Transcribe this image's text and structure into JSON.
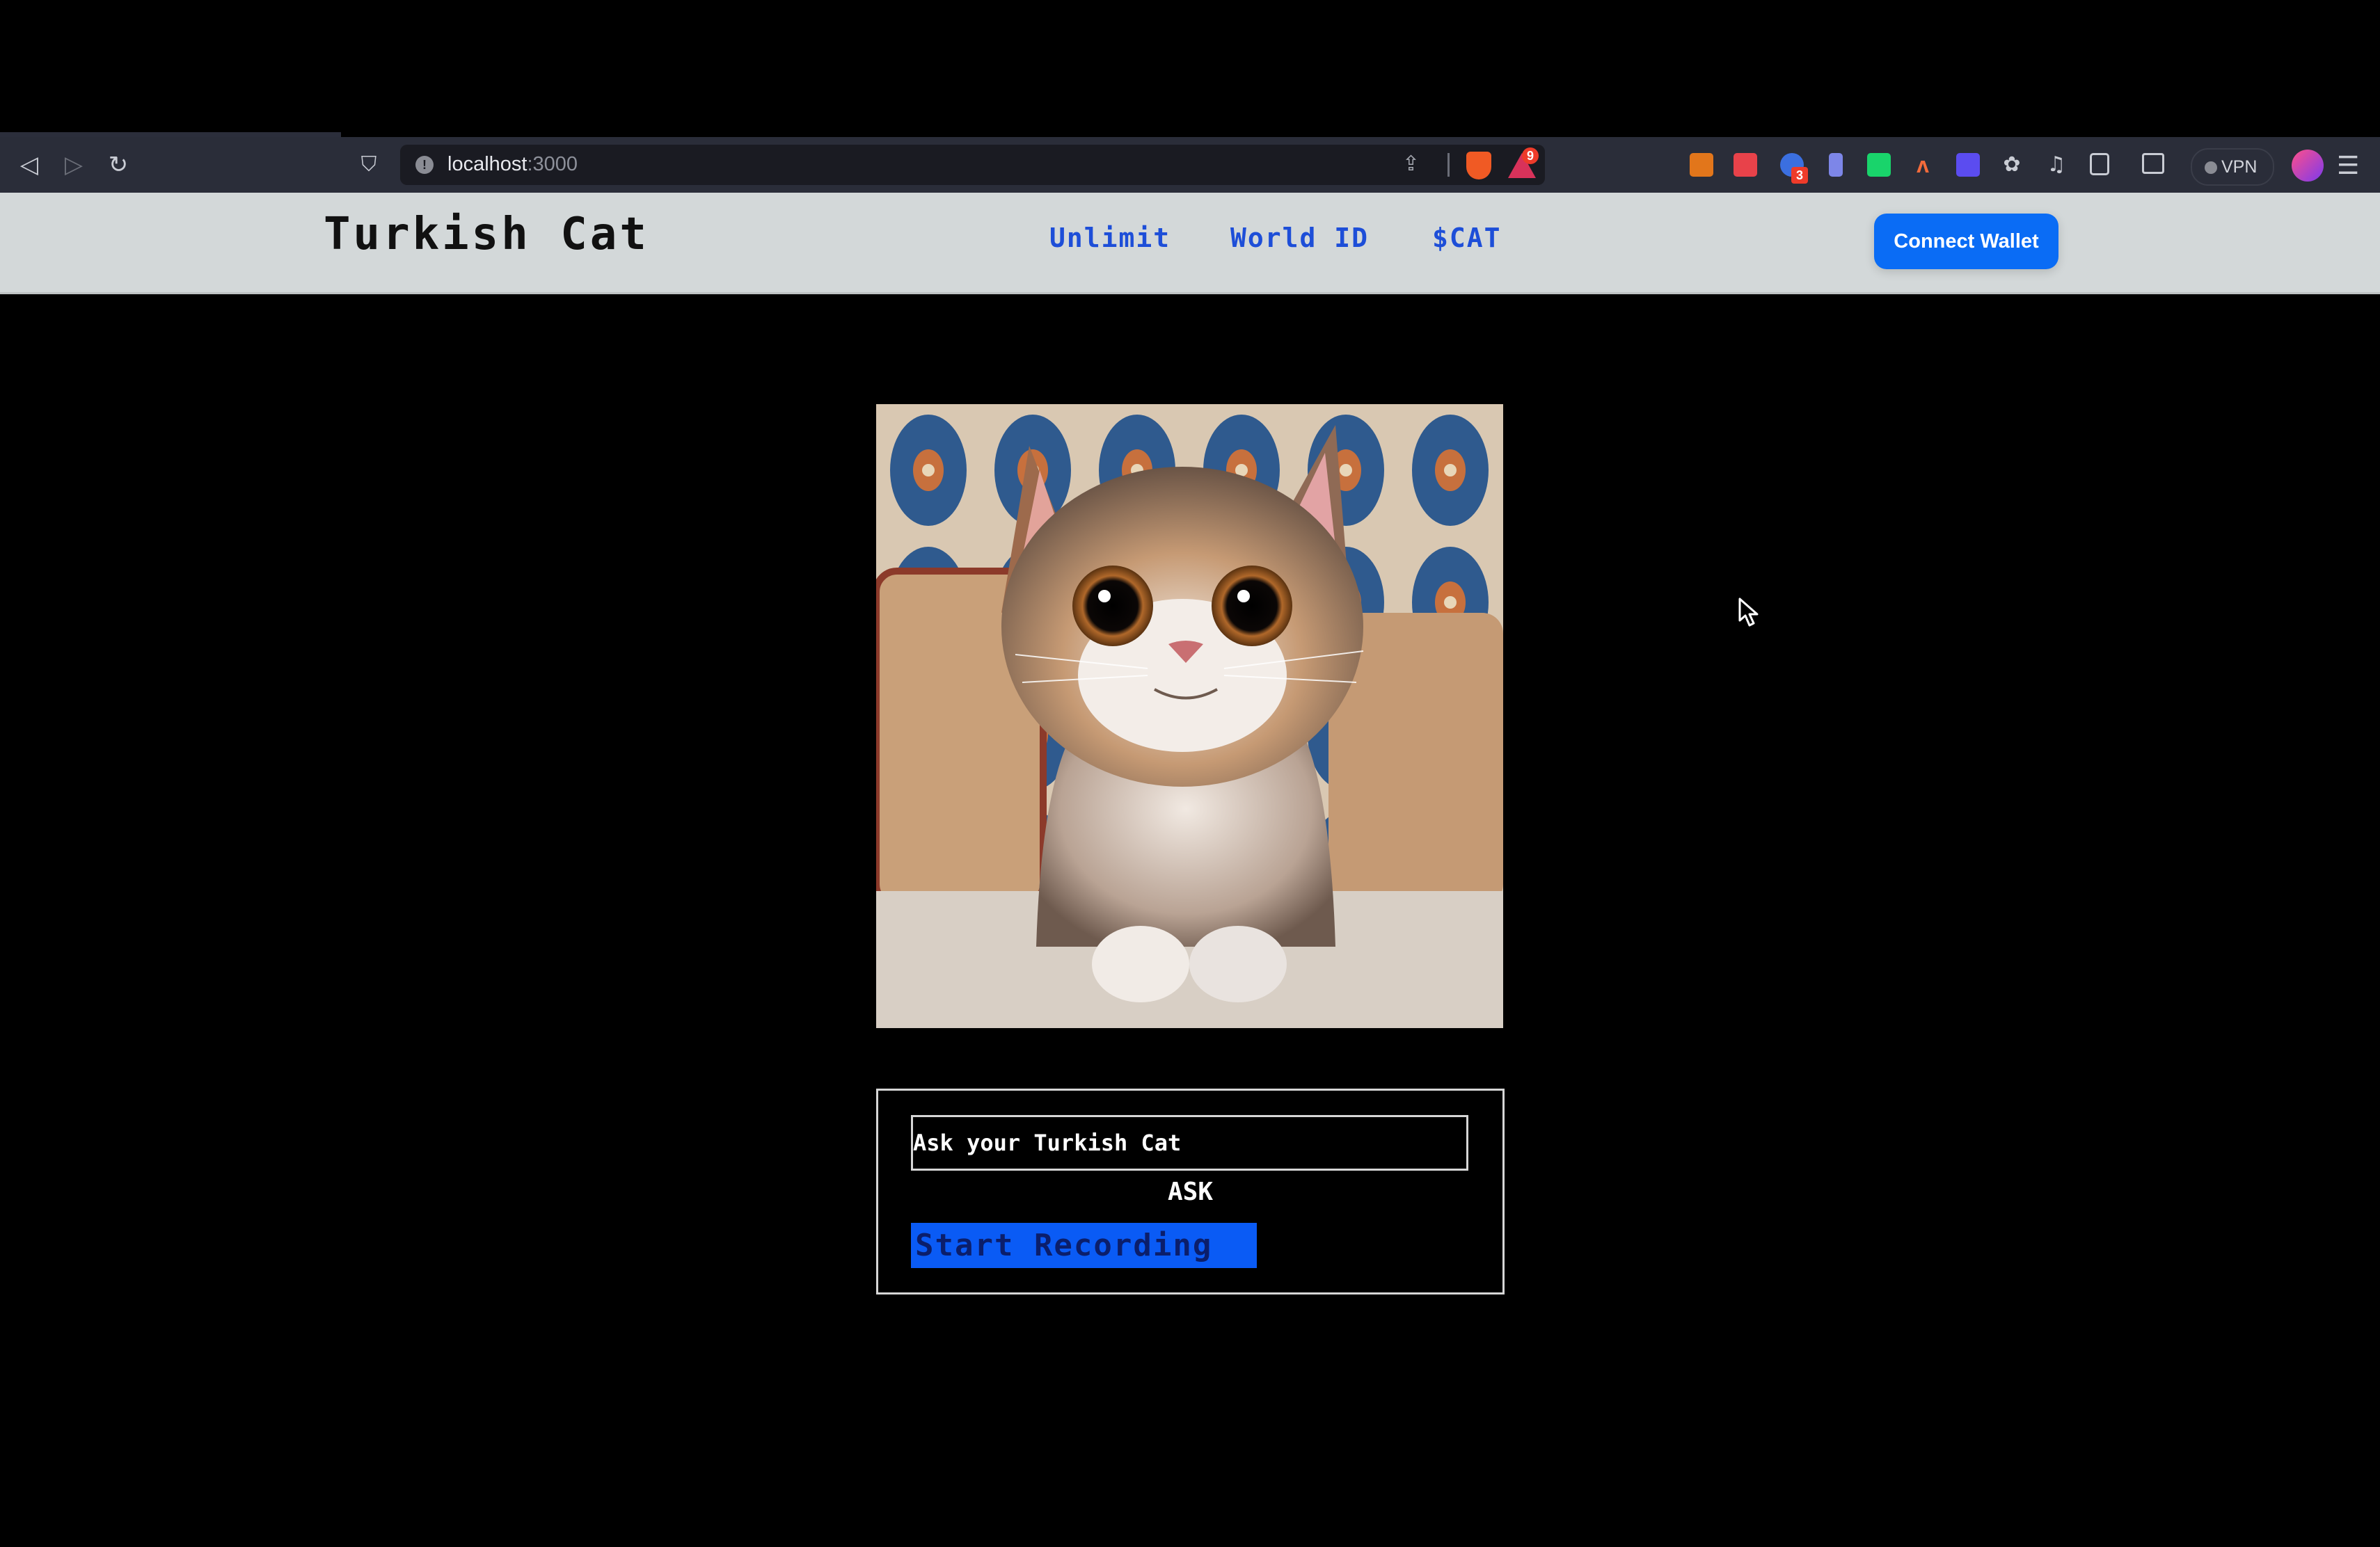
{
  "browser": {
    "url_host": "localhost",
    "url_port": ":3000",
    "rewards_badge": "9",
    "extension_badge": "3",
    "vpn_label": "VPN",
    "toolbar_icons": [
      "back-icon",
      "forward-icon",
      "reload-icon",
      "bookmark-icon",
      "site-info-icon",
      "share-icon",
      "brave-shield-icon",
      "brave-rewards-icon",
      "metamask-icon",
      "extension-p-icon",
      "extension-gear-icon",
      "extension-bookmark-icon",
      "extension-green-icon",
      "extension-orange-icon",
      "extension-purple-icon",
      "extensions-puzzle-icon",
      "media-icon",
      "sidebar-icon",
      "wallet-icon",
      "vpn-icon",
      "profile-avatar",
      "menu-icon"
    ]
  },
  "nav": {
    "brand": "Turkish Cat",
    "links": [
      {
        "label": "Unlimit"
      },
      {
        "label": "World ID"
      },
      {
        "label": "$CAT"
      }
    ],
    "connect_wallet": "Connect Wallet",
    "link_color": "#1d4ed8",
    "button_color": "#0a6cf5"
  },
  "main": {
    "image_alt": "Cute cartoon tabby-and-white kitten sitting on a sofa in front of patterned blue wallpaper",
    "ask": {
      "placeholder": "Ask your Turkish Cat",
      "value": "",
      "ask_label": "ASK",
      "record_label": "Start Recording"
    }
  }
}
